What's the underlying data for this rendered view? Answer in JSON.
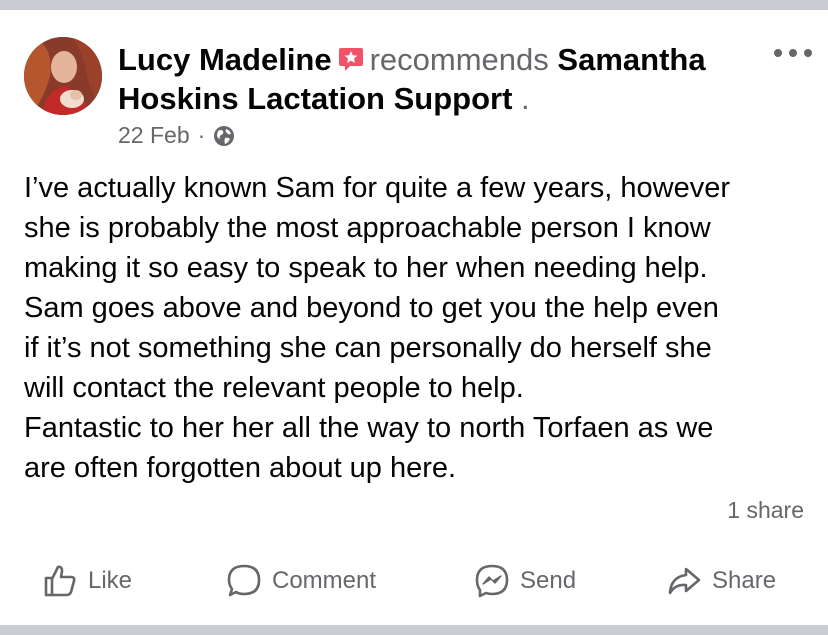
{
  "post": {
    "author": "Lucy Madeline",
    "verb": "recommends",
    "page_name": "Samantha Hoskins Lactation Support",
    "page_suffix": ".",
    "date": "22 Feb",
    "separator": "·",
    "audience_icon": "globe-icon",
    "recommend_badge_icon": "recommend-badge-icon",
    "body_lines": [
      "I’ve actually known Sam for quite a few years, however",
      "she is probably the most approachable person I know",
      "making it so easy to speak to her when needing help.",
      "Sam goes above and beyond to get you the help even",
      "if it’s not something she can personally do herself she",
      "will contact the relevant people to help.",
      "Fantastic to her her all the way to north Torfaen as we",
      "are often forgotten about up here."
    ],
    "share_count": "1 share"
  },
  "actions": {
    "like": "Like",
    "comment": "Comment",
    "send": "Send",
    "share": "Share"
  },
  "colors": {
    "muted_text": "#65676b",
    "main_text": "#050505",
    "badge_red": "#f25268",
    "divider": "#c9ccd1"
  }
}
